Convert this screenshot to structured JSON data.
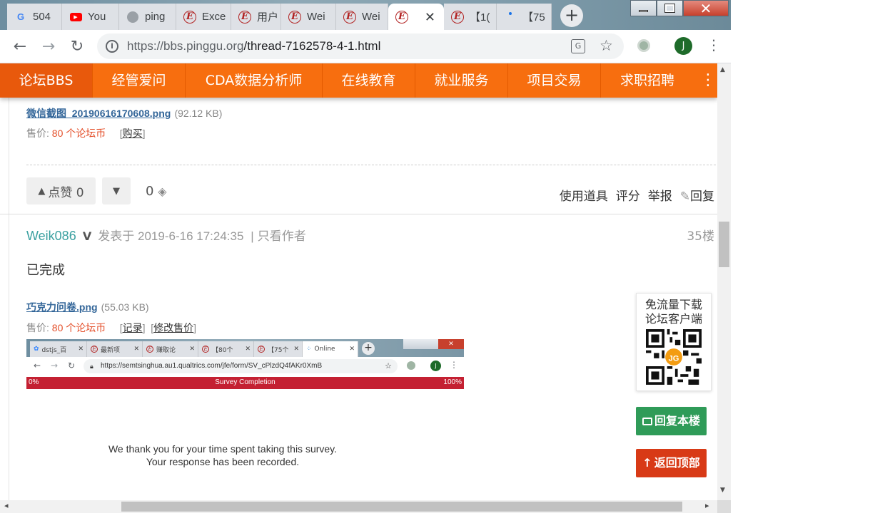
{
  "browser": {
    "tabs": [
      {
        "title": "504",
        "icon": "google-icon"
      },
      {
        "title": "You",
        "icon": "youtube-icon"
      },
      {
        "title": "ping",
        "icon": "globe-icon"
      },
      {
        "title": "Exce",
        "icon": "pinggu-icon"
      },
      {
        "title": "用户",
        "icon": "pinggu-icon"
      },
      {
        "title": "Wei",
        "icon": "pinggu-icon"
      },
      {
        "title": "Wei",
        "icon": "pinggu-icon"
      },
      {
        "title": "",
        "icon": "pinggu-icon",
        "active": true
      },
      {
        "title": "【1(",
        "icon": "pinggu-icon"
      },
      {
        "title": "【75",
        "icon": "loading-icon"
      }
    ],
    "new_tab": "+",
    "url_host": "https://bbs.pinggu.org",
    "url_path": "/thread-7162578-4-1.html",
    "profile_initial": "J"
  },
  "site_nav": {
    "items": [
      "论坛BBS",
      "经管爱问",
      "CDA数据分析师",
      "在线教育",
      "就业服务",
      "项目交易",
      "求职招聘"
    ],
    "more": "⋮"
  },
  "prev_post": {
    "attachment_name": "微信截图_20190616170608.png",
    "attachment_size": "(92.12 KB)",
    "price_label": "售价:",
    "price_value": "80 个论坛币",
    "buy_link": "购买",
    "like_label": "点赞 0",
    "score": "0",
    "actions": [
      "使用道具",
      "评分",
      "举报",
      "回复"
    ]
  },
  "post": {
    "author": "Weik086",
    "posted": "发表于 2019-6-16 17:24:35",
    "only_author": "只看作者",
    "floor": "35楼",
    "content": "已完成",
    "attachment_name": "巧克力问卷.png",
    "attachment_size": "(55.03 KB)",
    "price_label": "售价:",
    "price_value": "80 个论坛币",
    "record_link": "记录",
    "edit_price_link": "修改售价"
  },
  "embedded_screenshot": {
    "tabs": [
      "dstjs_百",
      "最新项",
      "赚取论",
      "【80个",
      "【75个",
      "Online"
    ],
    "url": "https://semtsinghua.au1.qualtrics.com/jfe/form/SV_cPlzdQ4fAKr0XmB",
    "profile_initial": "J",
    "progress_start": "0%",
    "progress_title": "Survey Completion",
    "progress_end": "100%",
    "thanks_line1": "We thank you for your time spent taking this survey.",
    "thanks_line2": "Your response has been recorded."
  },
  "widgets": {
    "qr_line1": "免流量下载",
    "qr_line2": "论坛客户端",
    "reply_floor": "回复本楼",
    "back_top": "返回顶部"
  },
  "colors": {
    "nav_orange": "#f76e0f",
    "author_teal": "#3aa0a0",
    "price_red": "#e4502b",
    "reply_green": "#2f9b58",
    "top_red": "#d83a16",
    "survey_red": "#c42032"
  }
}
